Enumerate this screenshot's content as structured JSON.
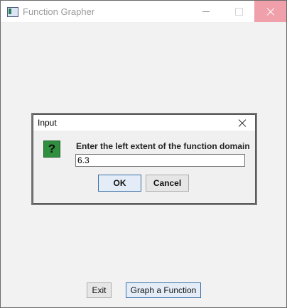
{
  "window": {
    "title": "Function Grapher",
    "app_icon": "app-window-icon"
  },
  "controls": {
    "minimize": "minimize-icon",
    "maximize": "maximize-icon",
    "close": "close-icon"
  },
  "main_buttons": {
    "exit_label": "Exit",
    "graph_label": "Graph a Function"
  },
  "dialog": {
    "title": "Input",
    "icon_glyph": "?",
    "prompt": "Enter the left extent of the function domain",
    "input_value": "6.3",
    "ok_label": "OK",
    "cancel_label": "Cancel"
  },
  "colors": {
    "close_hover": "#f0a0aa",
    "question_icon": "#2f8f3f",
    "focus_border": "#3a6fa8"
  }
}
